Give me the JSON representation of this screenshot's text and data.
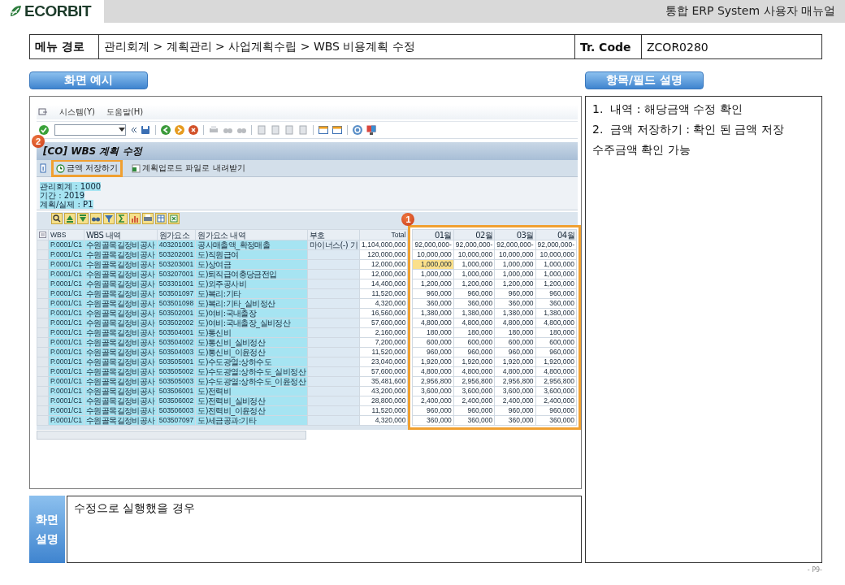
{
  "header": {
    "logo": "ECORBIT",
    "title": "통합 ERP System 사용자 매뉴얼"
  },
  "menu_path": {
    "label": "메뉴 경로",
    "path": "관리회계 > 계획관리 > 사업계획수립 > WBS 비용계획 수정",
    "code_label": "Tr. Code",
    "code": "ZCOR0280"
  },
  "screen_example": {
    "heading": "화면 예시",
    "sap": {
      "menu": [
        "시스템(Y)",
        "도움말(H)"
      ],
      "title": "[CO] WBS 계획 수정",
      "title_badge": "2",
      "buttons": [
        {
          "label": "금액 저장하기",
          "highlighted": true
        },
        {
          "label": "계획업로드 파일로 내려받기",
          "highlighted": false
        }
      ],
      "info": [
        "관리회계 : 1000",
        "기간 : 2019",
        "계획/실제 : P1"
      ],
      "grid": {
        "columns": [
          "WBS",
          "WBS 내역",
          "원가요소",
          "원가요소 내역",
          "부호",
          "Total"
        ],
        "month_columns": [
          "01월",
          "02월",
          "03월",
          "04월"
        ],
        "months_highlighted": true,
        "badge": "1",
        "rows": [
          {
            "wbs": "P.0001/C1",
            "wbs_name": "수원골목길정비공사",
            "cost_element": "403201001",
            "cost_element_name": "공사매출액_확정매출",
            "sign": "마이너스(-) 기",
            "total": "1,104,000,000",
            "months": [
              {
                "value": "92,000,000-",
                "selected": false
              },
              {
                "value": "92,000,000-",
                "selected": false
              },
              {
                "value": "92,000,000-",
                "selected": false
              },
              {
                "value": "92,000,000-",
                "selected": false
              }
            ]
          },
          {
            "wbs": "P.0001/C1",
            "wbs_name": "수원골목길정비공사",
            "cost_element": "503202001",
            "cost_element_name": "도)직원급여",
            "total": "120,000,000",
            "months": [
              {
                "value": "10,000,000",
                "selected": false
              },
              {
                "value": "10,000,000",
                "selected": false
              },
              {
                "value": "10,000,000",
                "selected": false
              },
              {
                "value": "10,000,000",
                "selected": false
              }
            ]
          },
          {
            "wbs": "P.0001/C1",
            "wbs_name": "수원골목길정비공사",
            "cost_element": "503203001",
            "cost_element_name": "도)상여금",
            "total": "12,000,000",
            "months": [
              {
                "value": "1,000,000",
                "selected": true
              },
              {
                "value": "1,000,000",
                "selected": false
              },
              {
                "value": "1,000,000",
                "selected": false
              },
              {
                "value": "1,000,000",
                "selected": false
              }
            ]
          },
          {
            "wbs": "P.0001/C1",
            "wbs_name": "수원골목길정비공사",
            "cost_element": "503207001",
            "cost_element_name": "도)퇴직급여충당금전입",
            "total": "12,000,000",
            "months": [
              {
                "value": "1,000,000",
                "selected": false
              },
              {
                "value": "1,000,000",
                "selected": false
              },
              {
                "value": "1,000,000",
                "selected": false
              },
              {
                "value": "1,000,000",
                "selected": false
              }
            ]
          },
          {
            "wbs": "P.0001/C1",
            "wbs_name": "수원골목길정비공사",
            "cost_element": "503301001",
            "cost_element_name": "도)외주공사비",
            "total": "14,400,000",
            "months": [
              {
                "value": "1,200,000",
                "selected": false
              },
              {
                "value": "1,200,000",
                "selected": false
              },
              {
                "value": "1,200,000",
                "selected": false
              },
              {
                "value": "1,200,000",
                "selected": false
              }
            ]
          },
          {
            "wbs": "P.0001/C1",
            "wbs_name": "수원골목길정비공사",
            "cost_element": "503501097",
            "cost_element_name": "도)복리:기타",
            "total": "11,520,000",
            "months": [
              {
                "value": "960,000",
                "selected": false
              },
              {
                "value": "960,000",
                "selected": false
              },
              {
                "value": "960,000",
                "selected": false
              },
              {
                "value": "960,000",
                "selected": false
              }
            ]
          },
          {
            "wbs": "P.0001/C1",
            "wbs_name": "수원골목길정비공사",
            "cost_element": "503501098",
            "cost_element_name": "도)복리:기타_실비정산",
            "total": "4,320,000",
            "months": [
              {
                "value": "360,000",
                "selected": false
              },
              {
                "value": "360,000",
                "selected": false
              },
              {
                "value": "360,000",
                "selected": false
              },
              {
                "value": "360,000",
                "selected": false
              }
            ]
          },
          {
            "wbs": "P.0001/C1",
            "wbs_name": "수원골목길정비공사",
            "cost_element": "503502001",
            "cost_element_name": "도)여비:국내출장",
            "total": "16,560,000",
            "months": [
              {
                "value": "1,380,000",
                "selected": false
              },
              {
                "value": "1,380,000",
                "selected": false
              },
              {
                "value": "1,380,000",
                "selected": false
              },
              {
                "value": "1,380,000",
                "selected": false
              }
            ]
          },
          {
            "wbs": "P.0001/C1",
            "wbs_name": "수원골목길정비공사",
            "cost_element": "503502002",
            "cost_element_name": "도)여비:국내출장_실비정산",
            "total": "57,600,000",
            "months": [
              {
                "value": "4,800,000",
                "selected": false
              },
              {
                "value": "4,800,000",
                "selected": false
              },
              {
                "value": "4,800,000",
                "selected": false
              },
              {
                "value": "4,800,000",
                "selected": false
              }
            ]
          },
          {
            "wbs": "P.0001/C1",
            "wbs_name": "수원골목길정비공사",
            "cost_element": "503504001",
            "cost_element_name": "도)통신비",
            "total": "2,160,000",
            "months": [
              {
                "value": "180,000",
                "selected": false
              },
              {
                "value": "180,000",
                "selected": false
              },
              {
                "value": "180,000",
                "selected": false
              },
              {
                "value": "180,000",
                "selected": false
              }
            ]
          },
          {
            "wbs": "P.0001/C1",
            "wbs_name": "수원골목길정비공사",
            "cost_element": "503504002",
            "cost_element_name": "도)통신비_실비정산",
            "total": "7,200,000",
            "months": [
              {
                "value": "600,000",
                "selected": false
              },
              {
                "value": "600,000",
                "selected": false
              },
              {
                "value": "600,000",
                "selected": false
              },
              {
                "value": "600,000",
                "selected": false
              }
            ]
          },
          {
            "wbs": "P.0001/C1",
            "wbs_name": "수원골목길정비공사",
            "cost_element": "503504003",
            "cost_element_name": "도)통신비_이윤정산",
            "total": "11,520,000",
            "months": [
              {
                "value": "960,000",
                "selected": false
              },
              {
                "value": "960,000",
                "selected": false
              },
              {
                "value": "960,000",
                "selected": false
              },
              {
                "value": "960,000",
                "selected": false
              }
            ]
          },
          {
            "wbs": "P.0001/C1",
            "wbs_name": "수원골목길정비공사",
            "cost_element": "503505001",
            "cost_element_name": "도)수도광열:상하수도",
            "total": "23,040,000",
            "months": [
              {
                "value": "1,920,000",
                "selected": false
              },
              {
                "value": "1,920,000",
                "selected": false
              },
              {
                "value": "1,920,000",
                "selected": false
              },
              {
                "value": "1,920,000",
                "selected": false
              }
            ]
          },
          {
            "wbs": "P.0001/C1",
            "wbs_name": "수원골목길정비공사",
            "cost_element": "503505002",
            "cost_element_name": "도)수도광열:상하수도_실비정산",
            "total": "57,600,000",
            "months": [
              {
                "value": "4,800,000",
                "selected": false
              },
              {
                "value": "4,800,000",
                "selected": false
              },
              {
                "value": "4,800,000",
                "selected": false
              },
              {
                "value": "4,800,000",
                "selected": false
              }
            ]
          },
          {
            "wbs": "P.0001/C1",
            "wbs_name": "수원골목길정비공사",
            "cost_element": "503505003",
            "cost_element_name": "도)수도광열:상하수도_이윤정산",
            "total": "35,481,600",
            "months": [
              {
                "value": "2,956,800",
                "selected": false
              },
              {
                "value": "2,956,800",
                "selected": false
              },
              {
                "value": "2,956,800",
                "selected": false
              },
              {
                "value": "2,956,800",
                "selected": false
              }
            ]
          },
          {
            "wbs": "P.0001/C1",
            "wbs_name": "수원골목길정비공사",
            "cost_element": "503506001",
            "cost_element_name": "도)전력비",
            "total": "43,200,000",
            "months": [
              {
                "value": "3,600,000",
                "selected": false
              },
              {
                "value": "3,600,000",
                "selected": false
              },
              {
                "value": "3,600,000",
                "selected": false
              },
              {
                "value": "3,600,000",
                "selected": false
              }
            ]
          },
          {
            "wbs": "P.0001/C1",
            "wbs_name": "수원골목길정비공사",
            "cost_element": "503506002",
            "cost_element_name": "도)전력비_실비정산",
            "total": "28,800,000",
            "months": [
              {
                "value": "2,400,000",
                "selected": false
              },
              {
                "value": "2,400,000",
                "selected": false
              },
              {
                "value": "2,400,000",
                "selected": false
              },
              {
                "value": "2,400,000",
                "selected": false
              }
            ]
          },
          {
            "wbs": "P.0001/C1",
            "wbs_name": "수원골목길정비공사",
            "cost_element": "503506003",
            "cost_element_name": "도)전력비_이윤정산",
            "total": "11,520,000",
            "months": [
              {
                "value": "960,000",
                "selected": false
              },
              {
                "value": "960,000",
                "selected": false
              },
              {
                "value": "960,000",
                "selected": false
              },
              {
                "value": "960,000",
                "selected": false
              }
            ]
          },
          {
            "wbs": "P.0001/C1",
            "wbs_name": "수원골목길정비공사",
            "cost_element": "503507097",
            "cost_element_name": "도)세금공과:기타",
            "total": "4,320,000",
            "months": [
              {
                "value": "360,000",
                "selected": false
              },
              {
                "value": "360,000",
                "selected": false
              },
              {
                "value": "360,000",
                "selected": false
              },
              {
                "value": "360,000",
                "selected": false
              }
            ]
          }
        ]
      }
    }
  },
  "field_description": {
    "heading": "항목/필드 설명",
    "lines": [
      "1.  내역 : 해당금액 수정 확인",
      "2.  금액 저장하기 : 확인 된 금액 저장",
      "수주금액 확인 가능"
    ]
  },
  "screen_note": {
    "label": [
      "화면",
      "설명"
    ],
    "text": "수정으로 실행했을 경우"
  },
  "page_number": "- P9-"
}
